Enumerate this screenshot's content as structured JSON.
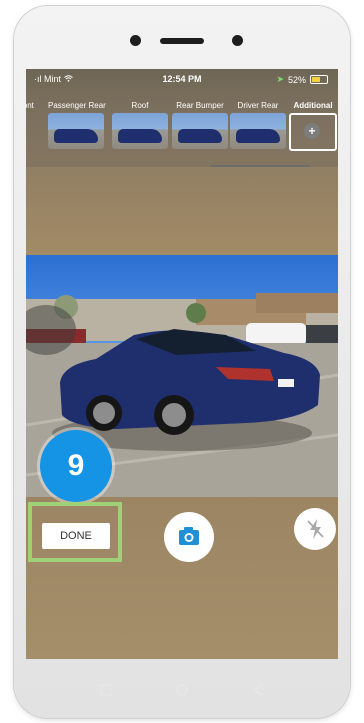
{
  "statusbar": {
    "carrier": "Mint",
    "time": "12:54 PM",
    "battery_text": "52%",
    "battery_level": 0.52
  },
  "thumbnails": [
    {
      "label": "ront",
      "type": "partial"
    },
    {
      "label": "Passenger Rear",
      "type": "photo"
    },
    {
      "label": "Roof",
      "type": "photo"
    },
    {
      "label": "Rear Bumper",
      "type": "photo"
    },
    {
      "label": "Driver Rear",
      "type": "photo"
    },
    {
      "label": "Additional",
      "type": "add",
      "active": true
    }
  ],
  "step_badge": "9",
  "done_label": "DONE",
  "icons": {
    "camera": "camera-icon",
    "flash": "flash-off-icon",
    "add": "plus-icon",
    "wifi": "wifi-icon",
    "location": "location-icon"
  },
  "colors": {
    "badge": "#1593e5",
    "highlight": "#9fd276",
    "camera_icon": "#1f8fd6",
    "car": "#1f2f6e"
  }
}
